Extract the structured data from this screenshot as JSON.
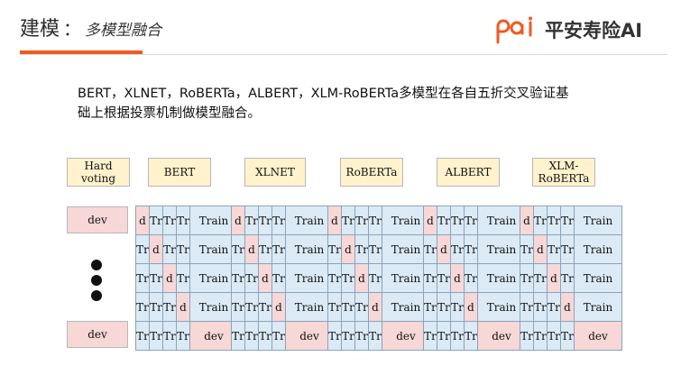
{
  "header": {
    "title_main": "建模",
    "title_sep": "：",
    "title_sub": "多模型融合",
    "logo_text": "平安寿险AI",
    "accent_color": "#f05a22"
  },
  "description": {
    "line1": "BERT，XLNET，RoBERTa，ALBERT，XLM-RoBERTa多模型在各自五折交叉验证基",
    "line2": "础上根据投票机制做模型融合。"
  },
  "diagram": {
    "voting_label": "Hard voting",
    "dev_label": "dev",
    "models": [
      "BERT",
      "XLNET",
      "RoBERTa",
      "ALBERT",
      "XLM-\nRoBERTa"
    ],
    "fold_cells": {
      "train_short": "Tr",
      "train_long": "Train",
      "dev_short": "d",
      "dev_long": "dev"
    },
    "colors": {
      "header_fill": "#fff2cc",
      "train_fill": "#dbeaf5",
      "dev_fill": "#f8d7d7"
    }
  }
}
